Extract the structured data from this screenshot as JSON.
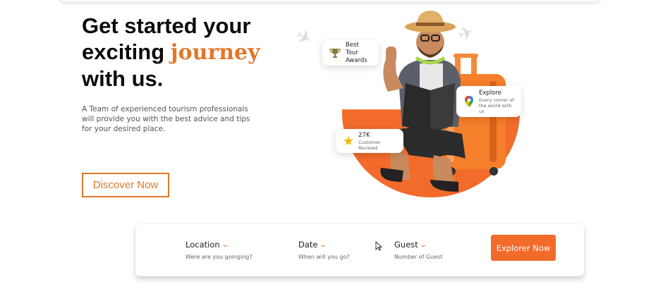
{
  "hero": {
    "title_line1": "Get started your",
    "title_line2_prefix": "exciting ",
    "title_accent": "journey",
    "title_line3": "with us.",
    "description": "A Team of experienced tourism professionals will provide you with the best advice and tips for your desired place.",
    "cta_label": "Discover Now"
  },
  "badges": {
    "award": {
      "title": "Best Tour",
      "subtitle": "Awards",
      "icon": "trophy-icon"
    },
    "explore": {
      "title": "Explore",
      "subtitle": "Every corner of the world with us",
      "icon": "map-pin-icon"
    },
    "review": {
      "title": "27K",
      "subtitle": "Customer Reviewd",
      "icon": "star-icon"
    }
  },
  "search": {
    "location": {
      "label": "Location",
      "hint": "Were are you goinging?"
    },
    "date": {
      "label": "Date",
      "hint": "When will you go?"
    },
    "guest": {
      "label": "Guest",
      "hint": "Number of Guest"
    },
    "submit_label": "Explorer Now"
  },
  "colors": {
    "accent": "#f26b2a",
    "accent_text": "#e2772a",
    "title": "#0c0c0c"
  }
}
